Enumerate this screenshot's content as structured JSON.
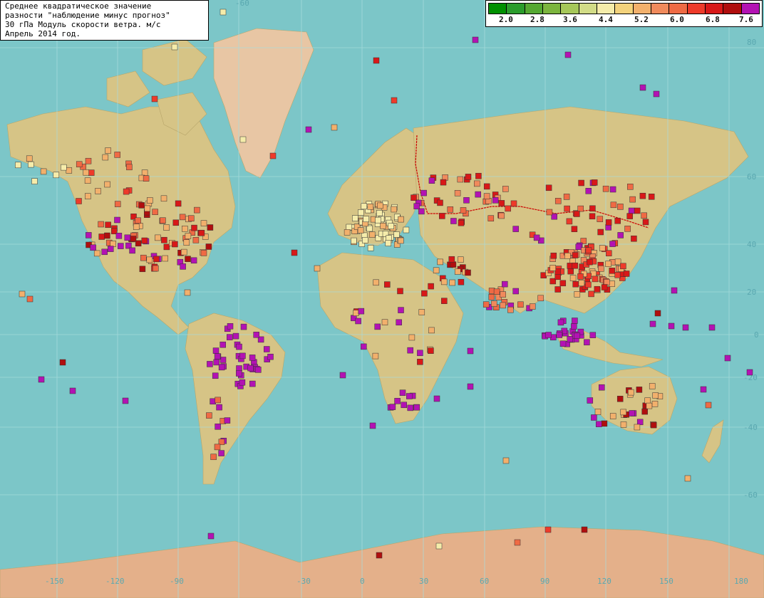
{
  "info": {
    "line1": "Среднее квадратическое значение",
    "line2": "разности \"наблюдение минус прогноз\"",
    "line3": "30 гПа Модуль скорости ветра. м/с",
    "line4": "Апрель 2014 год."
  },
  "legend": {
    "colors": [
      "#009000",
      "#2b9c2c",
      "#55a832",
      "#7cb53e",
      "#a6c759",
      "#d2dc87",
      "#f5ecaa",
      "#f3d27c",
      "#f2b06c",
      "#f08a5c",
      "#ef6a44",
      "#ee3a2a",
      "#d81818",
      "#b00e0e",
      "#b312b3"
    ],
    "labels": [
      "2.0",
      "2.8",
      "3.6",
      "4.4",
      "5.2",
      "6.0",
      "6.8",
      "7.6"
    ]
  },
  "lon_labels": [
    "-150",
    "-120",
    "-90",
    "-60",
    "-30",
    "0",
    "30",
    "60",
    "90",
    "120",
    "150",
    "180"
  ],
  "lat_labels": [
    "80",
    "60",
    "40",
    "20",
    "0",
    "-20",
    "-40",
    "-60"
  ],
  "colors": {
    "ocean": "#7cc6c8",
    "land": "#d9c48b",
    "grid": "#a8dcdc"
  }
}
